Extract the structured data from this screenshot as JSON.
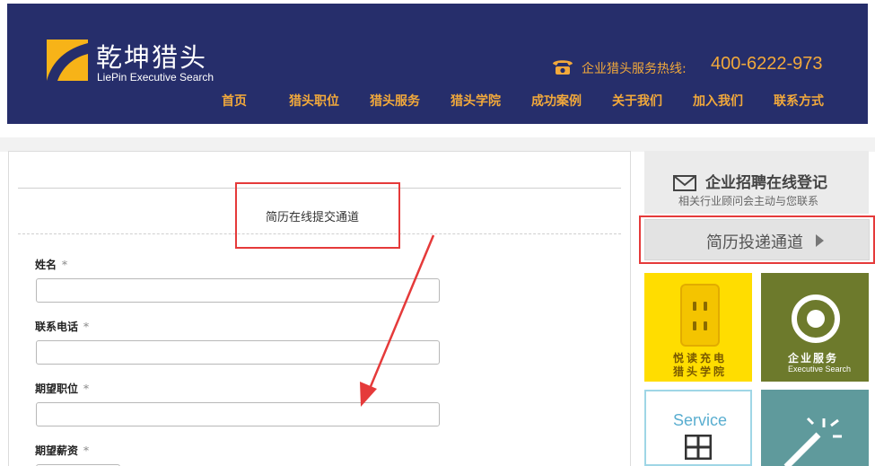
{
  "header": {
    "logo_cn": "乾坤猎头",
    "logo_en": "LiePin Executive Search",
    "hotline_label": "企业猎头服务热线:",
    "hotline_number": "400-6222-973",
    "nav": [
      "首页",
      "猎头职位",
      "猎头服务",
      "猎头学院",
      "成功案例",
      "关于我们",
      "加入我们",
      "联系方式"
    ]
  },
  "form": {
    "title": "简历在线提交通道",
    "required_mark": "*",
    "fields": [
      {
        "label": "姓名",
        "value": ""
      },
      {
        "label": "联系电话",
        "value": ""
      },
      {
        "label": "期望职位",
        "value": ""
      },
      {
        "label": "期望薪资",
        "value": ""
      }
    ]
  },
  "sidebar": {
    "register_title": "企业招聘在线登记",
    "register_sub": "相关行业顾问会主动与您联系",
    "resume_button": "简历投递通道",
    "tiles": {
      "yellow_line1": "悦读充电",
      "yellow_line2": "猎头学院",
      "olive_line1": "企业服务",
      "olive_line2": "Executive Search",
      "service": "Service"
    }
  },
  "colors": {
    "header_bg": "#262e6b",
    "accent_orange": "#f2a93b",
    "annotation_red": "#e53a3a",
    "tile_yellow": "#ffdd00",
    "tile_olive": "#6d7a2c",
    "tile_teal": "#5f9a9c"
  },
  "icons": [
    "logo-mark-icon",
    "phone-icon",
    "mail-icon",
    "play-arrow-icon",
    "socket-icon",
    "ring-icon",
    "grid-icon",
    "magic-wand-icon"
  ]
}
